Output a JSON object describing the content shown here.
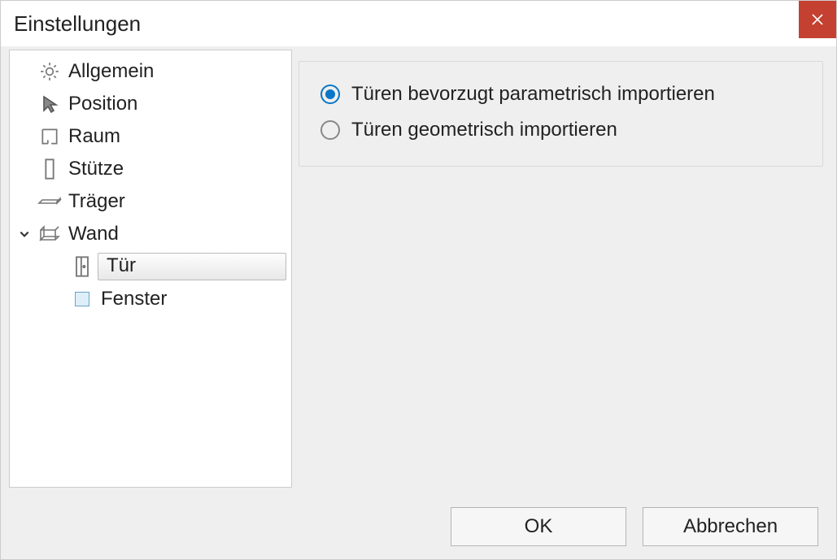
{
  "title": "Einstellungen",
  "tree": {
    "allgemein": "Allgemein",
    "position": "Position",
    "raum": "Raum",
    "stuetze": "Stütze",
    "traeger": "Träger",
    "wand": "Wand",
    "tuer": "Tür",
    "fenster": "Fenster"
  },
  "options": {
    "parametric": "Türen bevorzugt parametrisch importieren",
    "geometric": "Türen geometrisch importieren"
  },
  "buttons": {
    "ok": "OK",
    "cancel": "Abbrechen"
  }
}
